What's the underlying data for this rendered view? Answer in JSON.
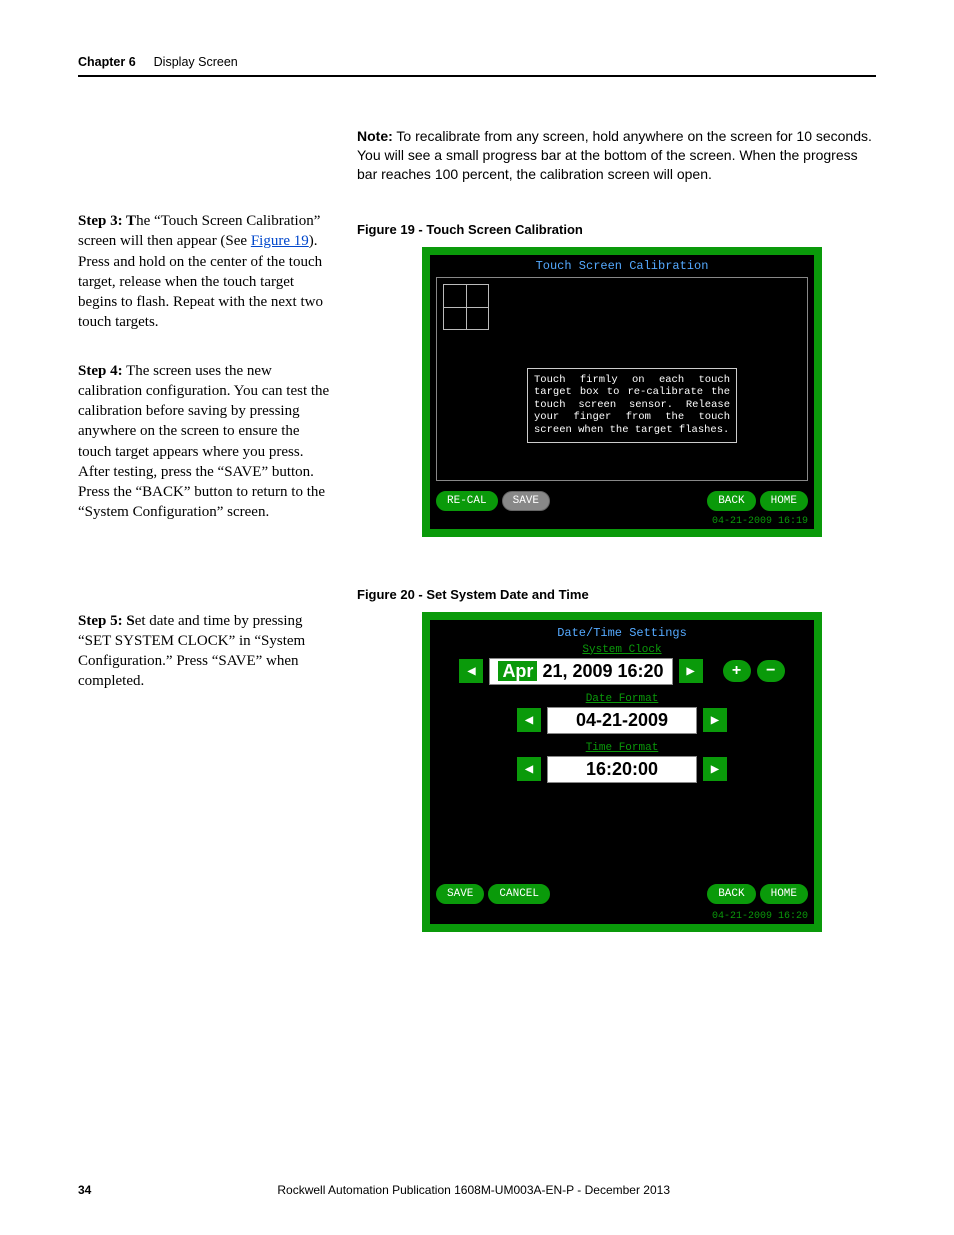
{
  "header": {
    "chapter": "Chapter 6",
    "title": "Display Screen"
  },
  "note": {
    "label": "Note:",
    "text": " To recalibrate from any screen, hold anywhere on the screen for 10 seconds. You will see a small progress bar at the bottom of the screen. When the progress bar reaches 100 percent, the calibration screen will open."
  },
  "steps": {
    "s3": {
      "lead": "Step 3: T",
      "rest": "he “Touch Screen Calibration” screen will then appear (See ",
      "linkText": "Figure 19",
      "rest2": "). Press and hold on the center of the touch target, release when the touch target begins to flash. Repeat with the next two touch targets."
    },
    "s4": {
      "lead": "Step 4:",
      "rest": " The screen uses the new calibration configuration. You can test the calibration before saving by pressing anywhere on the screen to ensure the touch target appears where you press. After testing, press the “SAVE” button. Press the “BACK” button to return to the “System Configuration” screen."
    },
    "s5": {
      "lead": "Step 5: S",
      "rest": "et date and time by pressing “SET SYSTEM CLOCK” in “System Configuration.” Press “SAVE” when completed."
    }
  },
  "fig19": {
    "caption": "Figure 19 - Touch Screen Calibration",
    "title": "Touch Screen Calibration",
    "message": "Touch firmly on each touch target box to re-calibrate the touch screen sensor. Release your finger from the touch screen when the target flashes.",
    "buttons": {
      "recal": "RE-CAL",
      "save": "SAVE",
      "back": "BACK",
      "home": "HOME"
    },
    "timestamp": "04-21-2009 16:19"
  },
  "fig20": {
    "caption": "Figure 20 - Set System Date and Time",
    "title": "Date/Time Settings",
    "clockLabel": "System Clock",
    "clockMonth": "Apr",
    "clockRest": " 21, 2009 16:20",
    "dateFormatLabel": "Date Format",
    "dateFormatValue": "04-21-2009",
    "timeFormatLabel": "Time Format",
    "timeFormatValue": "16:20:00",
    "plus": "+",
    "minus": "−",
    "buttons": {
      "save": "SAVE",
      "cancel": "CANCEL",
      "back": "BACK",
      "home": "HOME"
    },
    "timestamp": "04-21-2009 16:20"
  },
  "arrows": {
    "left": "◀",
    "right": "▶"
  },
  "footer": {
    "page": "34",
    "pub": "Rockwell Automation Publication 1608M-UM003A-EN-P - December 2013"
  }
}
